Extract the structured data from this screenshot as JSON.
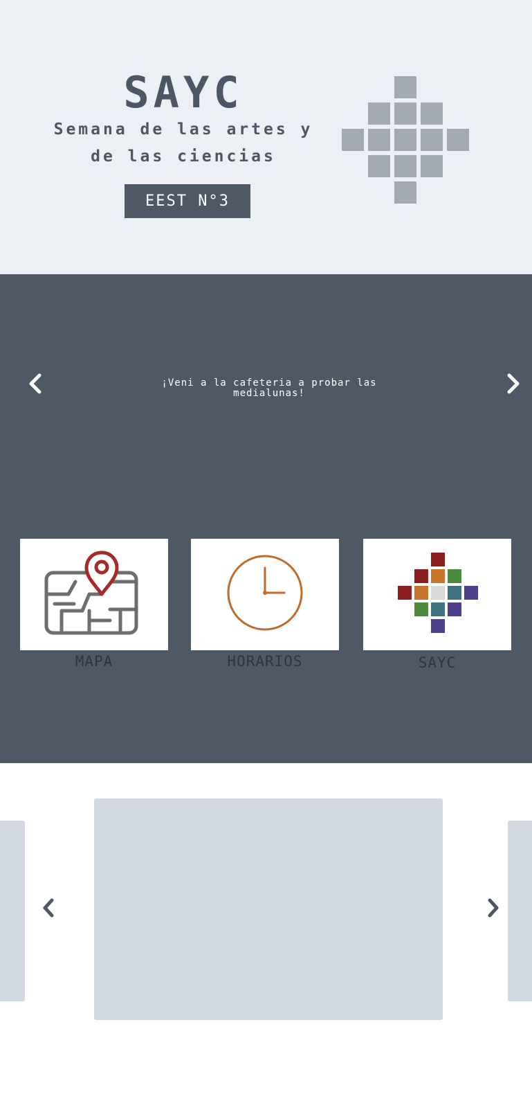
{
  "header": {
    "title": "SAYC",
    "subtitle_line1": "Semana de las artes y",
    "subtitle_line2": "de las ciencias",
    "school_button": "EEST N°3"
  },
  "announcement": {
    "text_line1": "¡Veni a la cafeteria a probar las",
    "text_line2": "medialunas!"
  },
  "menu": {
    "items": [
      {
        "label": "MAPA",
        "icon": "map-pin-icon"
      },
      {
        "label": "HORARIOS",
        "icon": "clock-icon"
      },
      {
        "label": "SAYC",
        "icon": "sayc-logo-icon"
      }
    ]
  },
  "colors": {
    "header_bg": "#eceff4",
    "band_bg": "#4f5966",
    "slide_bg": "#d3d9e2",
    "map_red": "#a52a2a",
    "clock_orange": "#c06a2b"
  }
}
